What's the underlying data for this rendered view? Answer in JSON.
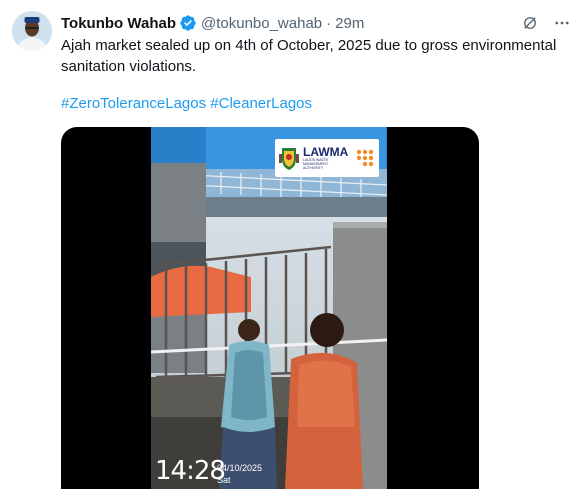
{
  "tweet": {
    "author_name": "Tokunbo Wahab",
    "handle": "@tokunbo_wahab",
    "separator": "·",
    "time": "29m",
    "text": "Ajah market sealed up on 4th of October, 2025 due to gross environmental sanitation violations.",
    "hashtags": [
      "#ZeroToleranceLagos",
      "#CleanerLagos"
    ]
  },
  "video": {
    "badge_title": "LAWMA",
    "badge_subtitle": "LAGOS WASTE MANAGEMENT AUTHORITY",
    "timestamp": "14:28",
    "date": "04/10/2025",
    "day": "Sat"
  },
  "colors": {
    "link": "#1d9bf0",
    "verified": "#1d9bf0",
    "secondary_text": "#536471"
  },
  "icons": [
    "verified-badge-icon",
    "grok-icon",
    "more-icon"
  ]
}
